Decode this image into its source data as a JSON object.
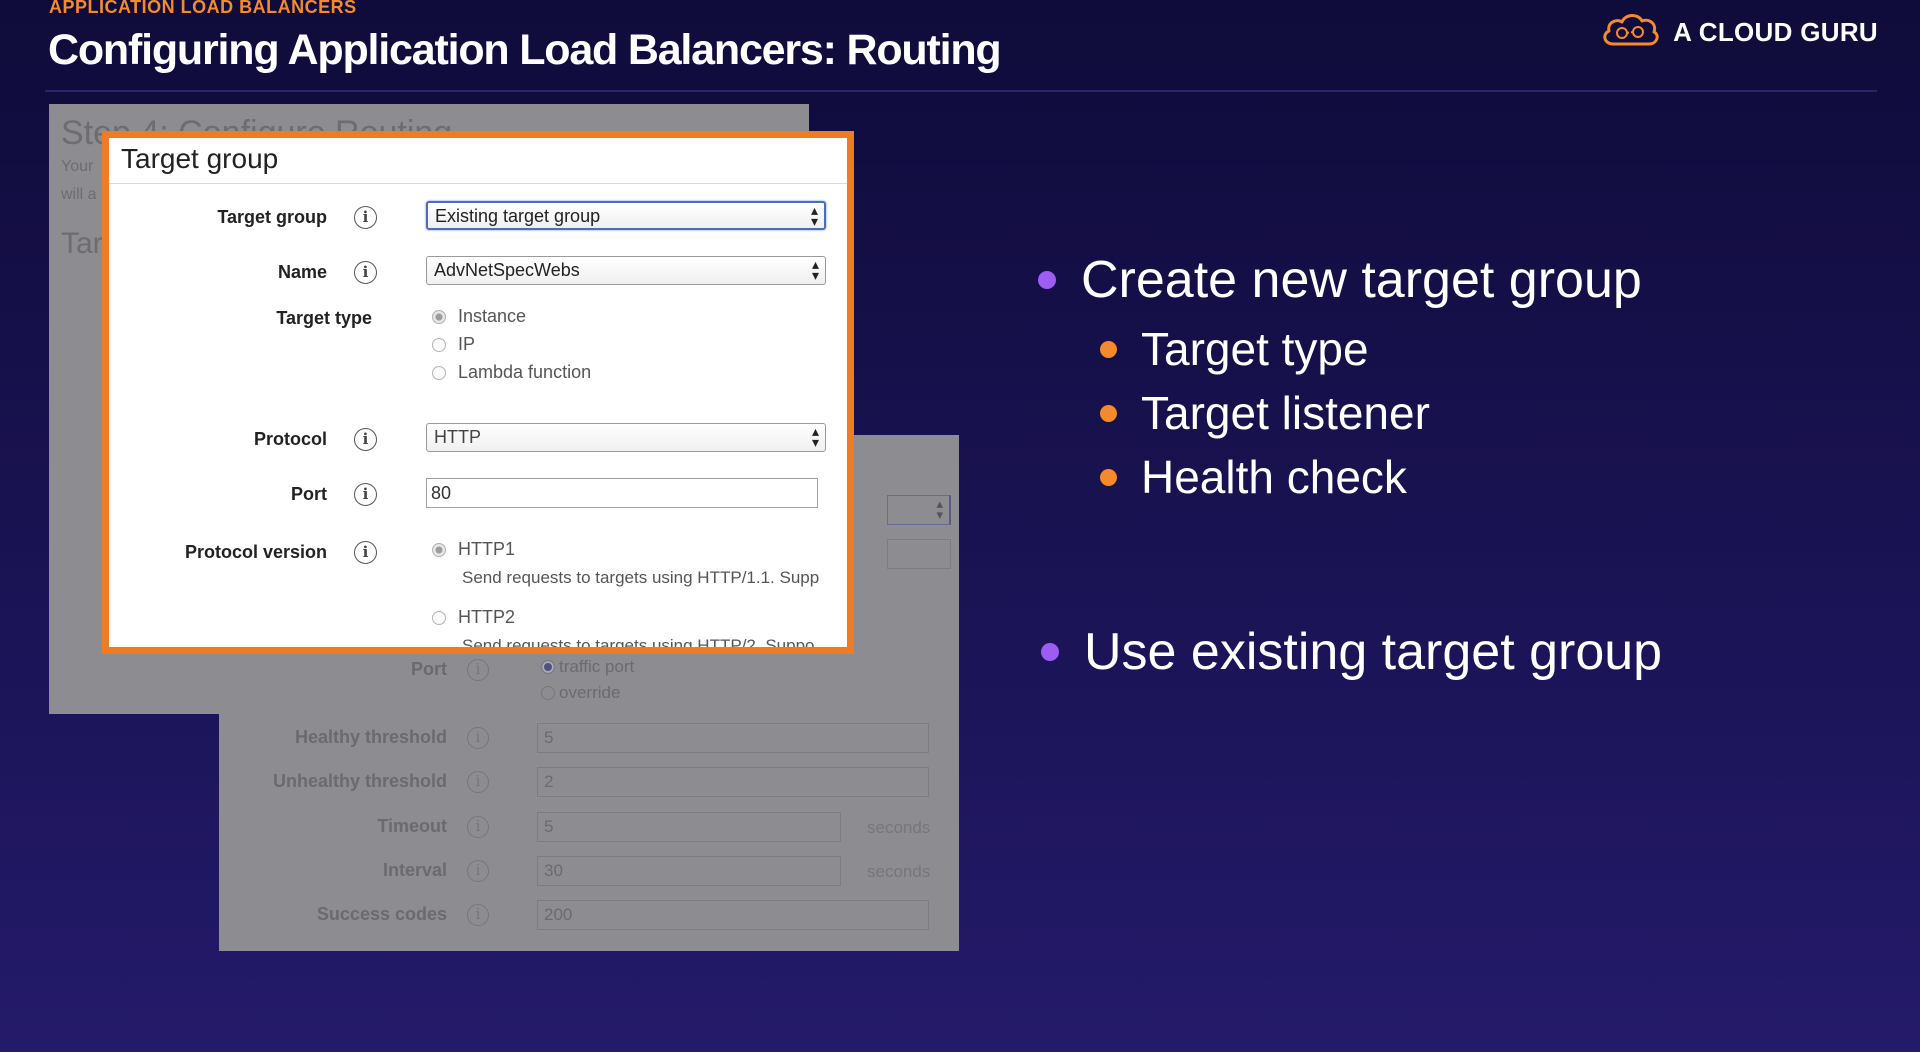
{
  "header": {
    "eyebrow": "APPLICATION LOAD BALANCERS",
    "title": "Configuring Application Load Balancers: Routing",
    "brand": "A CLOUD GURU",
    "brand_logo_icon": "cloud-logo-icon"
  },
  "background_console": {
    "step_title": "Step 4: Configure Routing",
    "line1": "Your",
    "line2": "will a",
    "section": "Tar",
    "fields": [
      {
        "label": "Port",
        "kind": "radio",
        "options": [
          "traffic port",
          "override"
        ],
        "selected": 0
      },
      {
        "label": "Healthy threshold",
        "value": "5"
      },
      {
        "label": "Unhealthy threshold",
        "value": "2"
      },
      {
        "label": "Timeout",
        "value": "5",
        "unit": "seconds"
      },
      {
        "label": "Interval",
        "value": "30",
        "unit": "seconds"
      },
      {
        "label": "Success codes",
        "value": "200"
      }
    ]
  },
  "form": {
    "heading": "Target group",
    "target_group": {
      "label": "Target group",
      "value": "Existing target group"
    },
    "name": {
      "label": "Name",
      "value": "AdvNetSpecWebs"
    },
    "target_type": {
      "label": "Target type",
      "options": [
        "Instance",
        "IP",
        "Lambda function"
      ],
      "selected": 0
    },
    "protocol": {
      "label": "Protocol",
      "value": "HTTP"
    },
    "port": {
      "label": "Port",
      "value": "80"
    },
    "protocol_version": {
      "label": "Protocol version",
      "options": [
        {
          "label": "HTTP1",
          "help": "Send requests to targets using HTTP/1.1. Supp"
        },
        {
          "label": "HTTP2",
          "help": "Send requests to targets using HTTP/2. Suppo"
        }
      ],
      "selected": 0
    },
    "info_glyph": "i"
  },
  "bullets": [
    {
      "text": "Create new target group",
      "level": 1,
      "color": "#9d5cf2"
    },
    {
      "text": "Target type",
      "level": 2,
      "color": "#f58a2c"
    },
    {
      "text": "Target listener",
      "level": 2,
      "color": "#f58a2c"
    },
    {
      "text": "Health check",
      "level": 2,
      "color": "#f58a2c"
    },
    {
      "text": "Use existing target group",
      "level": 1,
      "color": "#9d5cf2"
    }
  ],
  "colors": {
    "accent_orange": "#f58a2c",
    "bullet_purple": "#9d5cf2",
    "background": "#1a1354",
    "frame_orange": "#ee7c25"
  }
}
